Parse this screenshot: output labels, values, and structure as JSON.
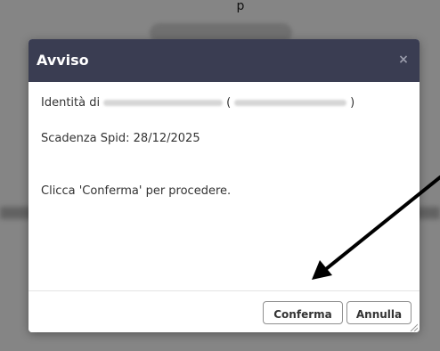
{
  "background": {
    "top_text": "p"
  },
  "dialog": {
    "title": "Avviso",
    "close_glyph": "×",
    "identity_prefix": "Identità di",
    "identity_open_paren": "(",
    "identity_close_paren": ")",
    "expiry_text": "Scadenza Spid: 28/12/2025",
    "instruction_text": "Clicca 'Conferma' per procedere.",
    "confirm_label": "Conferma",
    "cancel_label": "Annulla"
  },
  "colors": {
    "header_bg": "#3a3d52",
    "overlay": "rgba(0,0,0,0.48)",
    "arrow": "#000000"
  },
  "icons": {
    "close": "close-icon",
    "resize": "resize-grip-icon",
    "arrow": "annotation-arrow-icon"
  }
}
